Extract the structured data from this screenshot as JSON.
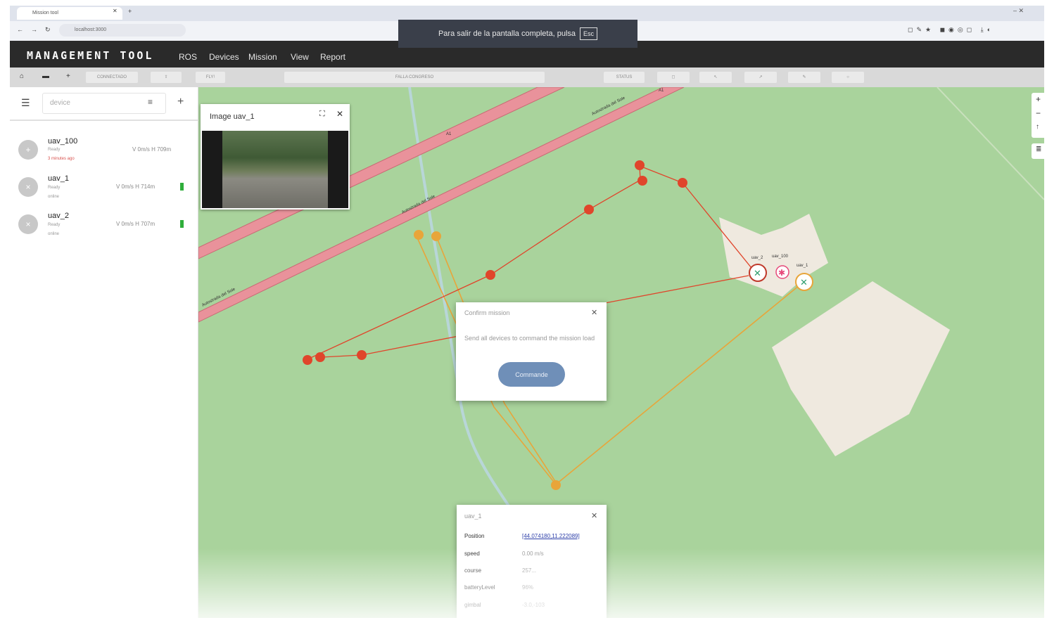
{
  "browser": {
    "tab_title": "Mission tool",
    "url": "localhost:3000",
    "fullscreen_notice": "Para salir de la pantalla completa, pulsa",
    "fullscreen_key": "Esc"
  },
  "app": {
    "title": "MANAGEMENT TOOL",
    "menu": [
      "ROS",
      "Devices",
      "Mission",
      "View",
      "Report"
    ]
  },
  "toolbar": {
    "connected_label": "CONNECTADO",
    "fly_label": "FLY!",
    "status_text": "FALLA CONGRESO",
    "status_label": "STATUS"
  },
  "sidebar": {
    "search_placeholder": "device",
    "devices": [
      {
        "name": "uav_100",
        "sub": "Ready",
        "time": "3 minutes ago",
        "vh": "V 0m/s  H 709m",
        "avatar": "+"
      },
      {
        "name": "uav_1",
        "sub": "Ready",
        "time": "online",
        "vh": "V 0m/s  H 714m",
        "avatar": "×"
      },
      {
        "name": "uav_2",
        "sub": "Ready",
        "time": "online",
        "vh": "V 0m/s  H 707m",
        "avatar": "×"
      }
    ]
  },
  "image_panel": {
    "title": "Image uav_1"
  },
  "map": {
    "road_labels": [
      "Autostrada del Sole",
      "Autostrada del Sole",
      "Autostrada del Sole",
      "A1",
      "A1",
      "A1"
    ],
    "uav_labels": [
      "uav_2",
      "uav_100",
      "uav_1"
    ],
    "colors": {
      "map_bg": "#a9d39c",
      "road": "#e9929b",
      "path_red": "#e0452b",
      "path_orange": "#e8a53a"
    }
  },
  "confirm_dialog": {
    "title": "Confirm mission",
    "text": "Send all devices to command the mission load",
    "button": "Commande"
  },
  "info_popup": {
    "title": "uav_1",
    "position_key": "Position",
    "position_value": "[44.074180,11.222089]",
    "rows": [
      {
        "key": "speed",
        "value": "0.00 m/s"
      },
      {
        "key": "course",
        "value": "257..."
      },
      {
        "key": "batteryLevel",
        "value": "96%"
      },
      {
        "key": "gimbal",
        "value": "-3.0,-103"
      }
    ]
  }
}
